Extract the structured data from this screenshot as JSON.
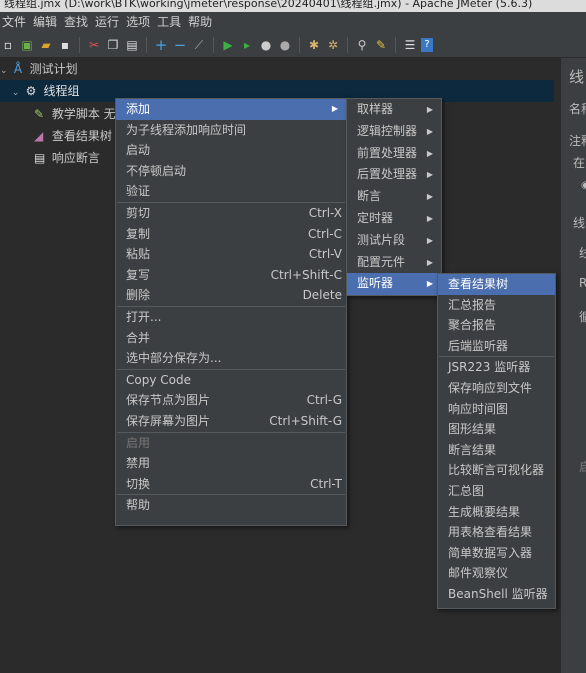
{
  "window": {
    "title": "线程组.jmx (D:\\work\\BTK\\working\\jmeter\\response\\20240401\\线程组.jmx) - Apache JMeter (5.6.3)"
  },
  "menubar": [
    "文件",
    "编辑",
    "查找",
    "运行",
    "选项",
    "工具",
    "帮助"
  ],
  "toolbar": {
    "icons": [
      "new-icon",
      "templates-icon",
      "open-icon",
      "save-icon",
      "cut-icon",
      "copy-icon",
      "paste-icon",
      "expand-icon",
      "collapse-icon",
      "toggle-icon",
      "start-icon",
      "start-no-pause-icon",
      "stop-icon",
      "shutdown-icon",
      "clear-icon",
      "clear-all-icon",
      "search-icon",
      "reset-search-icon",
      "function-helper-icon",
      "help-icon"
    ]
  },
  "tree": {
    "root": "测试计划",
    "thread_group": "线程组",
    "children": [
      "教学脚本 无",
      "查看结果树",
      "响应断言"
    ]
  },
  "right_panel": [
    "线",
    "名称",
    "注释",
    "在",
    "线",
    "线",
    "R",
    "循",
    "启"
  ],
  "context_menu": {
    "items": [
      {
        "label": "添加",
        "submenu": true
      },
      {
        "label": "为子线程添加响应时间"
      },
      {
        "label": "启动"
      },
      {
        "label": "不停顿启动"
      },
      {
        "label": "验证"
      },
      {
        "label": "剪切",
        "shortcut": "Ctrl-X"
      },
      {
        "label": "复制",
        "shortcut": "Ctrl-C"
      },
      {
        "label": "粘贴",
        "shortcut": "Ctrl-V"
      },
      {
        "label": "复写",
        "shortcut": "Ctrl+Shift-C"
      },
      {
        "label": "删除",
        "shortcut": "Delete"
      },
      {
        "label": "打开..."
      },
      {
        "label": "合并"
      },
      {
        "label": "选中部分保存为..."
      },
      {
        "label": "Copy Code"
      },
      {
        "label": "保存节点为图片",
        "shortcut": "Ctrl-G"
      },
      {
        "label": "保存屏幕为图片",
        "shortcut": "Ctrl+Shift-G"
      },
      {
        "label": "启用"
      },
      {
        "label": "禁用"
      },
      {
        "label": "切换",
        "shortcut": "Ctrl-T"
      },
      {
        "label": "帮助"
      }
    ]
  },
  "add_submenu": {
    "items": [
      "取样器",
      "逻辑控制器",
      "前置处理器",
      "后置处理器",
      "断言",
      "定时器",
      "测试片段",
      "配置元件",
      "监听器"
    ]
  },
  "listener_submenu": {
    "items": [
      "查看结果树",
      "汇总报告",
      "聚合报告",
      "后端监听器",
      "JSR223 监听器",
      "保存响应到文件",
      "响应时间图",
      "图形结果",
      "断言结果",
      "比较断言可视化器",
      "汇总图",
      "生成概要结果",
      "用表格查看结果",
      "简单数据写入器",
      "邮件观察仪",
      "BeanShell 监听器"
    ]
  },
  "colors": {
    "menu_highlight": "#4b6eaf",
    "tree_bg": "#2b2b2b",
    "panel_bg": "#3c3f41",
    "tree_selection": "#0d293e"
  }
}
